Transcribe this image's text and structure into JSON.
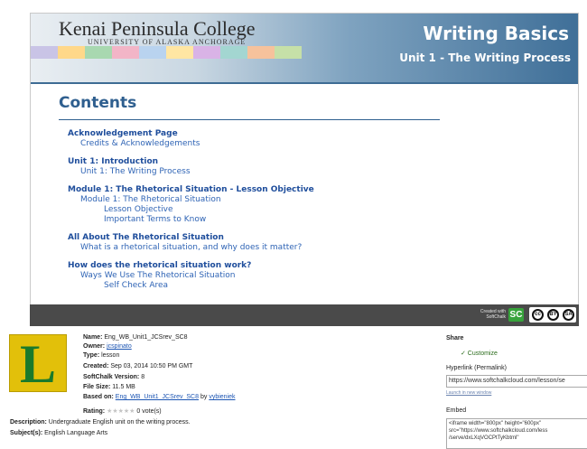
{
  "lesson": {
    "college": "Kenai Peninsula College",
    "university": "University of Alaska Anchorage",
    "course_title": "Writing Basics",
    "unit_title": "Unit 1 - The Writing Process",
    "contents_heading": "Contents",
    "toc": [
      {
        "section": "Acknowledgement Page",
        "items": [
          {
            "label": "Credits & Acknowledgements",
            "level": 1
          }
        ]
      },
      {
        "section": "Unit 1: Introduction",
        "items": [
          {
            "label": "Unit 1: The Writing Process",
            "level": 1
          }
        ]
      },
      {
        "section": "Module 1: The Rhetorical Situation - Lesson Objective",
        "items": [
          {
            "label": "Module 1: The Rhetorical Situation",
            "level": 1
          },
          {
            "label": "Lesson Objective",
            "level": 2
          },
          {
            "label": "Important Terms to Know",
            "level": 2
          }
        ]
      },
      {
        "section": "All About The Rhetorical Situation",
        "items": [
          {
            "label": "What is a rhetorical situation, and why does it matter?",
            "level": 1
          }
        ]
      },
      {
        "section": "How does the rhetorical situation work?",
        "items": [
          {
            "label": "Ways We Use The Rhetorical Situation",
            "level": 1
          },
          {
            "label": "Self Check Area",
            "level": 2
          }
        ]
      }
    ],
    "footer": {
      "created_with": "Created with SoftChalk",
      "sc_logo": "SC",
      "cc": "cc",
      "by": "BY",
      "sa": "SA"
    },
    "swatch_colors": [
      "#c9c4e6",
      "#ffd88a",
      "#a8d8b0",
      "#f2b5c7",
      "#b9d3ef",
      "#ffe6a3",
      "#d9b3e6",
      "#a3d6d1",
      "#f6c29c",
      "#c6e0a8"
    ]
  },
  "metadata": {
    "thumbnail_letter": "L",
    "name_label": "Name:",
    "name": "Eng_WB_Unit1_JCSrev_SC8",
    "owner_label": "Owner:",
    "owner": "jcspinato",
    "type_label": "Type:",
    "type": "lesson",
    "created_label": "Created:",
    "created": "Sep 03, 2014 10:50 PM GMT",
    "version_label": "SoftChalk Version:",
    "version": "8",
    "size_label": "File Size:",
    "size": "11.5 MB",
    "based_label": "Based on:",
    "based_on": "Eng_WB_Unit1_JCSrev_SC8",
    "by_word": "by",
    "based_by": "vybieniek",
    "rating_label": "Rating:",
    "stars": "★★★★★",
    "votes": "0 vote(s)",
    "description_label": "Description:",
    "description": "Undergraduate English unit on the writing process.",
    "subjects_label": "Subject(s):",
    "subjects": "English Language Arts"
  },
  "share": {
    "title": "Share",
    "customize": "✓ Customize",
    "permalink_label": "Hyperlink (Permalink)",
    "permalink": "https://www.softchalkcloud.com/lesson/se",
    "launch": "Launch in new window",
    "embed_label": "Embed",
    "embed": "<iframe width=\"800px\" height=\"600px\"\nsrc=\"https://www.softchalkcloud.com/less\n/serve/dxLXqVOCPtTyKbtml\""
  }
}
